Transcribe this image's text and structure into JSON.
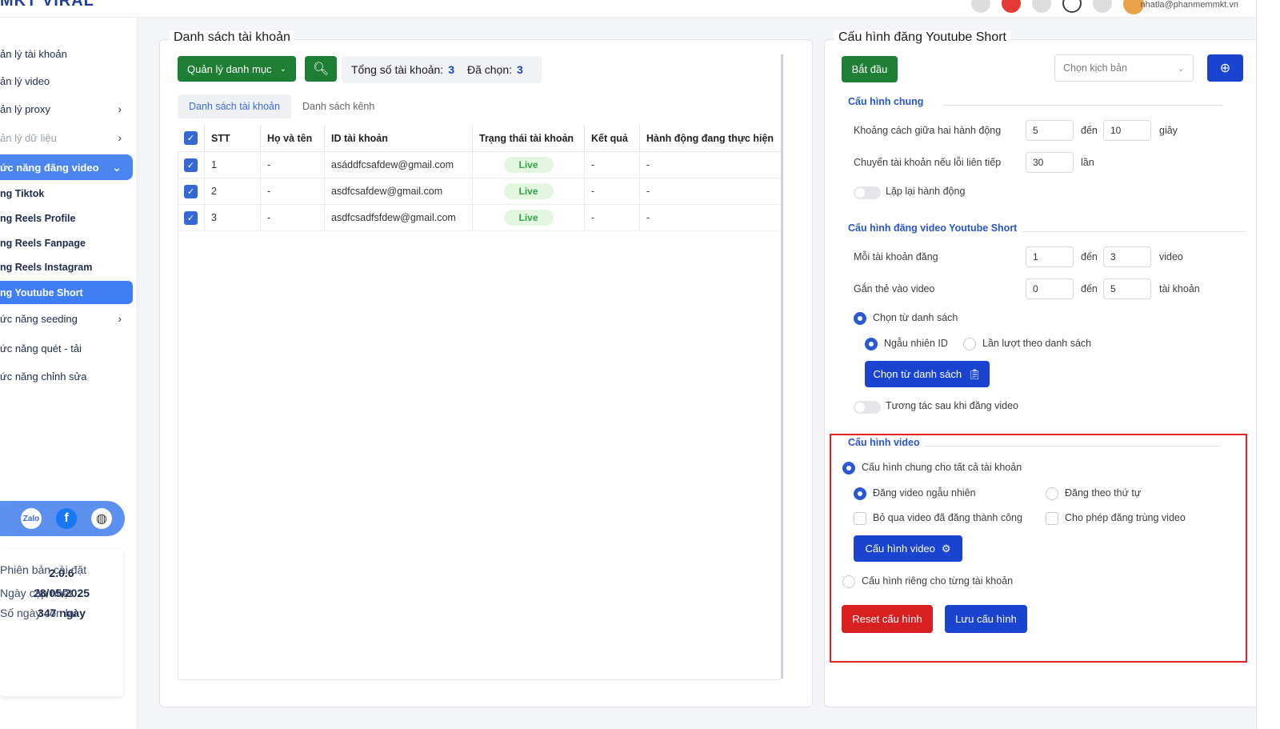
{
  "app": {
    "logo": "MKT VIRAL",
    "user_email": "nhatla@phanmemmkt.vn"
  },
  "sidebar": {
    "items": [
      {
        "label": "ản lý tài khoản",
        "chev": ""
      },
      {
        "label": "ản lý video",
        "chev": ""
      },
      {
        "label": "ản lý proxy",
        "chev": "›"
      },
      {
        "label": "ản lý dữ liệu",
        "chev": "›"
      },
      {
        "label": "ức năng đăng video",
        "chev": "⌄"
      },
      {
        "label": "ng Tiktok"
      },
      {
        "label": "ng Reels Profile"
      },
      {
        "label": "ng Reels Fanpage"
      },
      {
        "label": "ng Reels Instagram"
      },
      {
        "label": "ng Youtube Short"
      },
      {
        "label": "ức năng seeding",
        "chev": "›"
      },
      {
        "label": "ức năng quét - tải"
      },
      {
        "label": "ức năng chỉnh sửa"
      }
    ],
    "social": {
      "zalo": "Zalo",
      "facebook": "f",
      "web": "◍"
    },
    "info": {
      "version_label": "Phiên bản cài đặt",
      "version": "2.0.6",
      "update_label": "Ngày cập nhật",
      "update": "28/05/2025",
      "days_label": "Số ngày còn lại",
      "days": "347 ngày"
    }
  },
  "accounts_panel": {
    "title": "Danh sách tài khoản",
    "category_button": "Quản lý danh mục",
    "total_label": "Tổng số tài khoản:",
    "total": "3",
    "selected_label": "Đã chọn:",
    "selected": "3",
    "tabs": [
      "Danh sách tài khoản",
      "Danh sách kênh"
    ],
    "columns": [
      "STT",
      "Họ và tên",
      "ID tài khoản",
      "Trạng thái tài khoản",
      "Kết quả",
      "Hành động đang thực hiện"
    ],
    "rows": [
      {
        "stt": "1",
        "name": "-",
        "id": "asáddfcsafdew@gmail.com",
        "status": "Live",
        "result": "-",
        "action": "-"
      },
      {
        "stt": "2",
        "name": "-",
        "id": "asdfcsafdew@gmail.com",
        "status": "Live",
        "result": "-",
        "action": "-"
      },
      {
        "stt": "3",
        "name": "-",
        "id": "asdfcsadfsfdew@gmail.com",
        "status": "Live",
        "result": "-",
        "action": "-"
      }
    ]
  },
  "config_panel": {
    "title": "Cấu hình đăng Youtube Short",
    "start_button": "Bắt đầu",
    "script_placeholder": "Chọn kịch bản",
    "general": {
      "title": "Cấu hình chung",
      "interval_label": "Khoảng cách giữa hai hành động",
      "interval_from": "5",
      "interval_to": "10",
      "to_word": "đến",
      "interval_unit": "giây",
      "switch_label": "Chuyển tài khoản nếu lỗi liên tiếp",
      "switch_value": "30",
      "switch_unit": "lần",
      "repeat_label": "Lặp lại hành động"
    },
    "upload": {
      "title": "Cấu hình đăng video Youtube Short",
      "per_account_label": "Mỗi tài khoản đăng",
      "per_from": "1",
      "per_to": "3",
      "per_unit": "video",
      "tag_label": "Gắn thẻ vào video",
      "tag_from": "0",
      "tag_to": "5",
      "tag_unit": "tài khoản",
      "from_list": "Chọn từ danh sách",
      "random_id": "Ngẫu nhiên ID",
      "sequential": "Lần lượt theo danh sách",
      "from_list_button": "Chọn từ danh sách",
      "interact_label": "Tương tác sau khi đăng video"
    },
    "video": {
      "title": "Cấu hình video",
      "common_all": "Cấu hình chung cho tất cả tài khoản",
      "random": "Đăng video ngẫu nhiên",
      "ordered": "Đăng theo thứ tự",
      "skip_success": "Bỏ qua video đã đăng thành công",
      "allow_dup": "Cho phép đăng trùng video",
      "video_button": "Cấu hình video",
      "per_account": "Cấu hình riêng cho từng tài khoản"
    },
    "reset_button": "Reset cấu hình",
    "save_button": "Lưu cấu hình"
  }
}
